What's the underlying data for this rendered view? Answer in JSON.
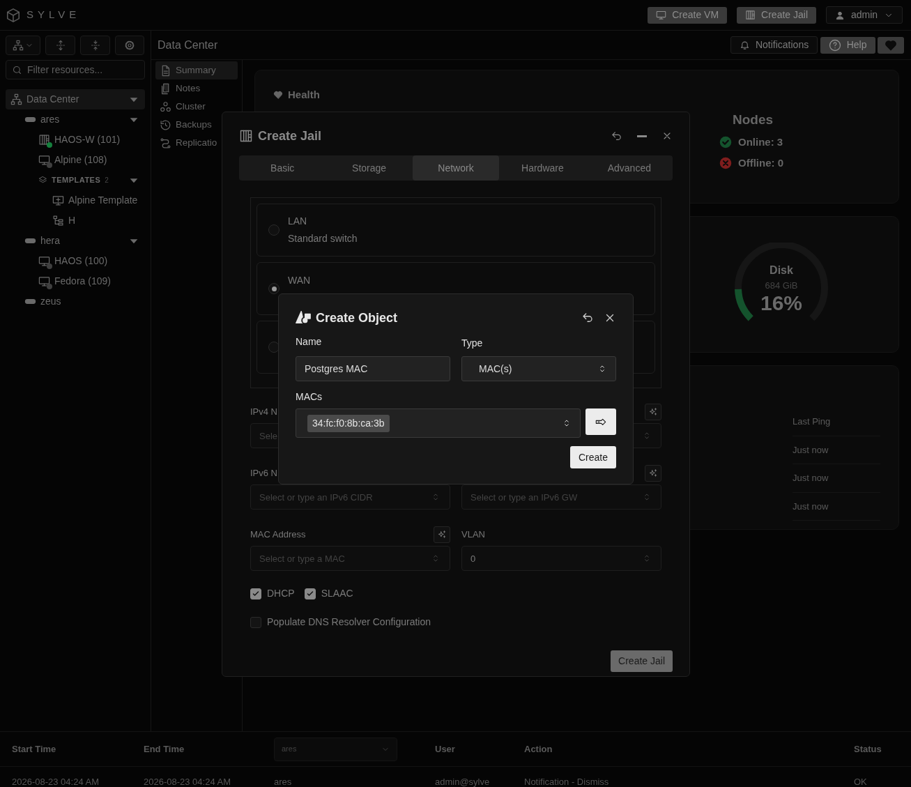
{
  "app": {
    "brand": "SYLVE"
  },
  "top_actions": [
    {
      "label": "Create VM",
      "kind": "vm"
    },
    {
      "label": "Create Jail",
      "kind": "jail"
    }
  ],
  "user_menu": {
    "label": "admin"
  },
  "sidebar": {
    "filter_placeholder": "Filter resources...",
    "tree": [
      {
        "label": "Data Center",
        "kind": "datacenter",
        "selected": true,
        "expanded": true,
        "children": [
          {
            "label": "ares",
            "kind": "node",
            "selected": false,
            "expanded": true,
            "children": [
              {
                "label": "HAOS-W (101)",
                "kind": "jail",
                "selected": false,
                "color": "#15803d"
              },
              {
                "label": "Alpine (108)",
                "kind": "vm",
                "selected": false,
                "color": "#3f3f3f"
              },
              {
                "label": "TEMPLATES",
                "count": "2",
                "kind": "group",
                "selected": false,
                "expanded": true,
                "children": [
                  {
                    "label": "Alpine Template",
                    "kind": "template",
                    "selected": false
                  },
                  {
                    "label": "H",
                    "kind": "jail-template",
                    "selected": false
                  }
                ]
              }
            ]
          },
          {
            "label": "hera",
            "kind": "node",
            "selected": false,
            "expanded": true,
            "children": [
              {
                "label": "HAOS (100)",
                "kind": "vm",
                "selected": false,
                "color": "#3f3f3f"
              },
              {
                "label": "Fedora (109)",
                "kind": "vm",
                "selected": false,
                "color": "#3f3f3f"
              }
            ]
          },
          {
            "label": "zeus",
            "kind": "node",
            "selected": false
          }
        ]
      }
    ]
  },
  "breadcrumb": "Data Center",
  "header_actions": [
    {
      "label": "Notifications",
      "kind": "bell"
    },
    {
      "label": "Help",
      "kind": "help"
    },
    {
      "kind": "heart"
    }
  ],
  "submenu": [
    {
      "label": "Summary",
      "kind": "summary",
      "selected": true
    },
    {
      "label": "Notes",
      "kind": "notes",
      "selected": false
    },
    {
      "label": "Cluster",
      "kind": "cluster",
      "selected": false
    },
    {
      "label": "Backups",
      "kind": "backups",
      "selected": false
    },
    {
      "label": "Replicatio",
      "kind": "replication",
      "selected": false
    }
  ],
  "health": {
    "title": "Health",
    "nodes_title": "Nodes",
    "online": "Online: 3",
    "offline": "Offline: 0"
  },
  "disk": {
    "label": "Disk",
    "size": "684 GiB",
    "percent": "16%",
    "level": 0.16
  },
  "nodes_table": {
    "column": "Last Ping",
    "rows": [
      "Just now",
      "Just now",
      "Just now"
    ]
  },
  "create_jail": {
    "title": "Create Jail",
    "tabs": [
      {
        "label": "Basic",
        "selected": false
      },
      {
        "label": "Storage",
        "selected": false
      },
      {
        "label": "Network",
        "selected": true
      },
      {
        "label": "Hardware",
        "selected": false
      },
      {
        "label": "Advanced",
        "selected": false
      }
    ],
    "switches": [
      {
        "name": "LAN",
        "description": "Standard switch",
        "selected": false
      },
      {
        "name": "WAN",
        "selected": true
      },
      {
        "selected": false
      }
    ],
    "ipv4": {
      "label": "IPv4 N",
      "placeholder": "Sele"
    },
    "ipv6": {
      "label": "IPv6 N",
      "cidr_placeholder": "Select or type an IPv6 CIDR",
      "gw_placeholder": "Select or type an IPv6 GW"
    },
    "mac": {
      "label": "MAC Address",
      "placeholder": "Select or type a MAC"
    },
    "vlan": {
      "label": "VLAN",
      "value": "0"
    },
    "options": [
      {
        "label": "DHCP",
        "checked": true
      },
      {
        "label": "SLAAC",
        "checked": true
      },
      {
        "label": "Populate DNS Resolver Configuration",
        "checked": false
      }
    ],
    "submit": "Create Jail"
  },
  "create_object": {
    "title": "Create Object",
    "name_label": "Name",
    "name_value": "Postgres MAC",
    "type_label": "Type",
    "type_value": "MAC(s)",
    "macs_label": "MACs",
    "macs": [
      "34:fc:f0:8b:ca:3b"
    ],
    "submit": "Create"
  },
  "audit_log": {
    "columns": [
      {
        "kind": "text",
        "label": "Start Time"
      },
      {
        "kind": "text",
        "label": "End Time"
      },
      {
        "kind": "select",
        "value": "ares"
      },
      {
        "kind": "text",
        "label": "User"
      },
      {
        "kind": "text",
        "label": "Action"
      },
      {
        "kind": "text",
        "label": "Status"
      }
    ],
    "rows": [
      [
        "2026-08-23 04:24 AM",
        "2026-08-23 04:24 AM",
        "ares",
        "admin@sylve",
        "Notification - Dismiss",
        "OK"
      ]
    ]
  }
}
